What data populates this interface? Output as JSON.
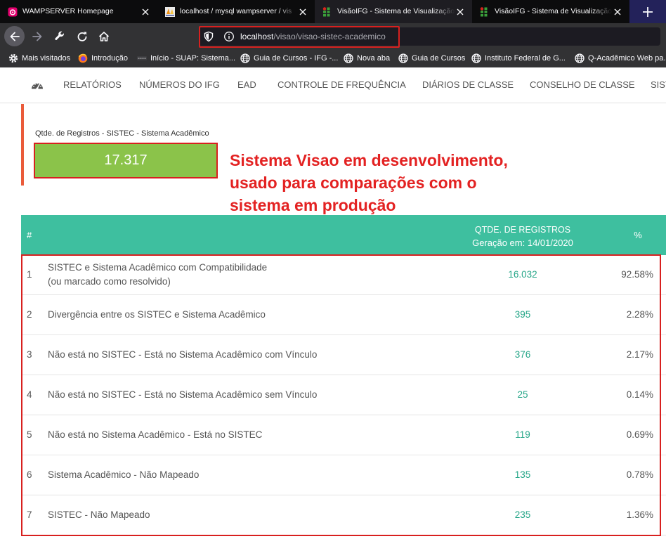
{
  "browser": {
    "tabs": [
      {
        "title": "WAMPSERVER Homepage",
        "icon": "wampserver-icon"
      },
      {
        "title": "localhost / mysql wampserver / vis",
        "icon": "phpmyadmin-icon"
      },
      {
        "title": "VisãoIFG - Sistema de Visualização",
        "icon": "visaoifg-icon"
      },
      {
        "title": "VisãoIFG - Sistema de Visualização",
        "icon": "visaoifg-icon"
      }
    ],
    "url": {
      "host": "localhost",
      "path": "/visao/visao-sistec-academico"
    },
    "bookmarks": [
      {
        "label": "Mais visitados",
        "icon": "gear-icon"
      },
      {
        "label": "Introdução",
        "icon": "firefox-icon"
      },
      {
        "label": "Início - SUAP: Sistema...",
        "icon": "suap-icon"
      },
      {
        "label": "Guia de Cursos - IFG -...",
        "icon": "globe-icon"
      },
      {
        "label": "Nova aba",
        "icon": "globe-icon"
      },
      {
        "label": "Guia de Cursos",
        "icon": "globe-icon"
      },
      {
        "label": "Instituto Federal de G...",
        "icon": "globe-icon"
      },
      {
        "label": "Q-Acadêmico Web pa...",
        "icon": "globe-icon"
      }
    ]
  },
  "nav": {
    "icon": "dashboard-icon",
    "items": [
      "RELATÓRIOS",
      "NÚMEROS DO IFG",
      "EAD",
      "CONTROLE DE FREQUÊNCIA",
      "DIÁRIOS DE CLASSE",
      "CONSELHO DE CLASSE",
      "SIST"
    ]
  },
  "kpi": {
    "label": "Qtde. de Registros - SISTEC - Sistema Acadêmico",
    "value": "17.317"
  },
  "annotation": {
    "lines": [
      "Sistema Visao em desenvolvimento,",
      "usado para comparações com o",
      "sistema em produção"
    ]
  },
  "table": {
    "header": {
      "index": "#",
      "qty": "QTDE. DE REGISTROS",
      "generated": "Geração em: 14/01/2020",
      "pct": "%"
    },
    "rows": [
      {
        "index": "1",
        "label": "SISTEC e Sistema Acadêmico com Compatibilidade",
        "sublabel": "(ou marcado como resolvido)",
        "qty": "16.032",
        "pct": "92.58%"
      },
      {
        "index": "2",
        "label": "Divergência entre os SISTEC e Sistema Acadêmico",
        "qty": "395",
        "pct": "2.28%"
      },
      {
        "index": "3",
        "label": "Não está no SISTEC - Está no Sistema Acadêmico com Vínculo",
        "qty": "376",
        "pct": "2.17%"
      },
      {
        "index": "4",
        "label": "Não está no SISTEC - Está no Sistema Acadêmico sem Vínculo",
        "qty": "25",
        "pct": "0.14%"
      },
      {
        "index": "5",
        "label": "Não está no Sistema Acadêmico - Está no SISTEC",
        "qty": "119",
        "pct": "0.69%"
      },
      {
        "index": "6",
        "label": "Sistema Acadêmico - Não Mapeado",
        "qty": "135",
        "pct": "0.78%"
      },
      {
        "index": "7",
        "label": "SISTEC - Não Mapeado",
        "qty": "235",
        "pct": "1.36%"
      }
    ]
  },
  "colors": {
    "teal": "#3ebf9f",
    "kpi": "#8bc34a",
    "red": "#e32222",
    "bar": "#ea5b3a",
    "num": "#26a688"
  }
}
